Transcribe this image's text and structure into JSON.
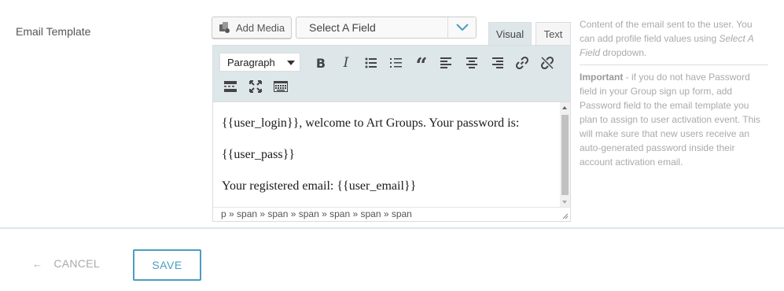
{
  "field_label": "Email Template",
  "media": {
    "add_media_label": "Add Media"
  },
  "select_field": {
    "value": "Select A Field"
  },
  "tabs": {
    "visual": "Visual",
    "text": "Text"
  },
  "toolbar": {
    "format": "Paragraph",
    "buttons": [
      "bold",
      "italic",
      "bullet-list",
      "numbered-list",
      "blockquote",
      "align-left",
      "align-center",
      "align-right",
      "insert-link",
      "remove-link",
      "read-more",
      "fullscreen",
      "toolbar-toggle"
    ]
  },
  "editor": {
    "lines": [
      "{{user_login}}, welcome to Art Groups. Your password is:",
      "{{user_pass}}",
      "Your registered email: {{user_email}}"
    ],
    "path": "p » span » span » span » span » span » span"
  },
  "help": {
    "intro_before": "Content of the email sent to the user. You can add profile field values using ",
    "intro_em": "Select A Field",
    "intro_after": " dropdown.",
    "important_label": "Important",
    "important_text": " - if you do not have Password field in your Group sign up form, add Password field to the email template you plan to assign to user activation event. This will make sure that new users receive an auto-generated password inside their account activation email."
  },
  "actions": {
    "cancel_arrow": "←",
    "cancel_label": "CANCEL",
    "save_label": "SAVE"
  },
  "colors": {
    "accent": "#4a9dc2",
    "toolbar_bg": "#dde6e9",
    "muted_text": "#aaaaaa"
  }
}
